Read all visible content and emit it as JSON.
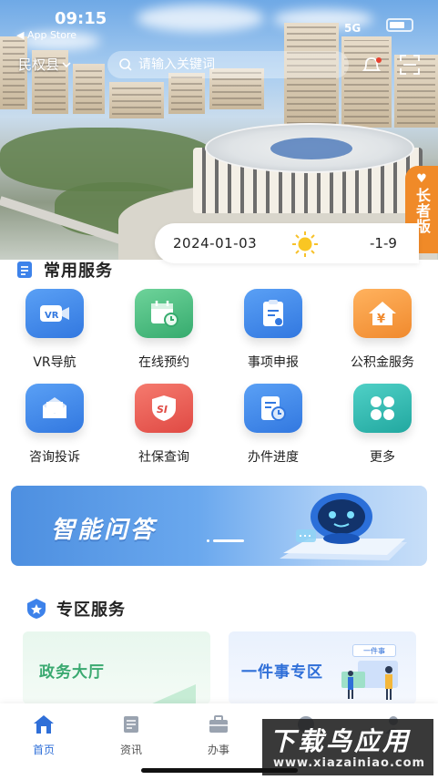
{
  "status_bar": {
    "time": "09:15",
    "back_label": "◀ App Store",
    "network": "5G"
  },
  "header": {
    "location": "民权县",
    "search_placeholder": "请输入关键词"
  },
  "elder_mode": {
    "label": "长者版"
  },
  "weather": {
    "date": "2024-01-03",
    "condition_icon": "sun-icon",
    "temperature": "-1-9"
  },
  "common_services": {
    "title": "常用服务",
    "items": [
      {
        "label": "VR导航",
        "icon": "vr-icon",
        "color": "#3d82ea"
      },
      {
        "label": "在线预约",
        "icon": "calendar-icon",
        "color": "#3fba7c"
      },
      {
        "label": "事项申报",
        "icon": "clipboard-icon",
        "color": "#3d82ea"
      },
      {
        "label": "公积金服务",
        "icon": "house-yuan-icon",
        "color": "#f39a3a"
      },
      {
        "label": "咨询投诉",
        "icon": "envelope-icon",
        "color": "#3d82ea"
      },
      {
        "label": "社保查询",
        "icon": "social-security-icon",
        "color": "#e5504a"
      },
      {
        "label": "办件进度",
        "icon": "progress-doc-icon",
        "color": "#3d82ea"
      },
      {
        "label": "更多",
        "icon": "clover-icon",
        "color": "#2fb5ae"
      }
    ]
  },
  "qa_banner": {
    "title": "智能问答"
  },
  "zone_services": {
    "title": "专区服务",
    "cards": [
      {
        "label": "政务大厅",
        "color": "#3aa970"
      },
      {
        "label": "一件事专区",
        "color": "#2f6fd8",
        "badge": "一件事"
      }
    ]
  },
  "tabbar": {
    "tabs": [
      {
        "label": "首页",
        "icon": "home-icon"
      },
      {
        "label": "资讯",
        "icon": "news-icon"
      },
      {
        "label": "办事",
        "icon": "briefcase-icon"
      },
      {
        "label": "",
        "icon": "service-icon"
      },
      {
        "label": "",
        "icon": "user-icon"
      }
    ],
    "active_color": "#2f6fd8"
  },
  "watermark": {
    "line1": "下载鸟应用",
    "line2": "www.xiazainiao.com"
  }
}
